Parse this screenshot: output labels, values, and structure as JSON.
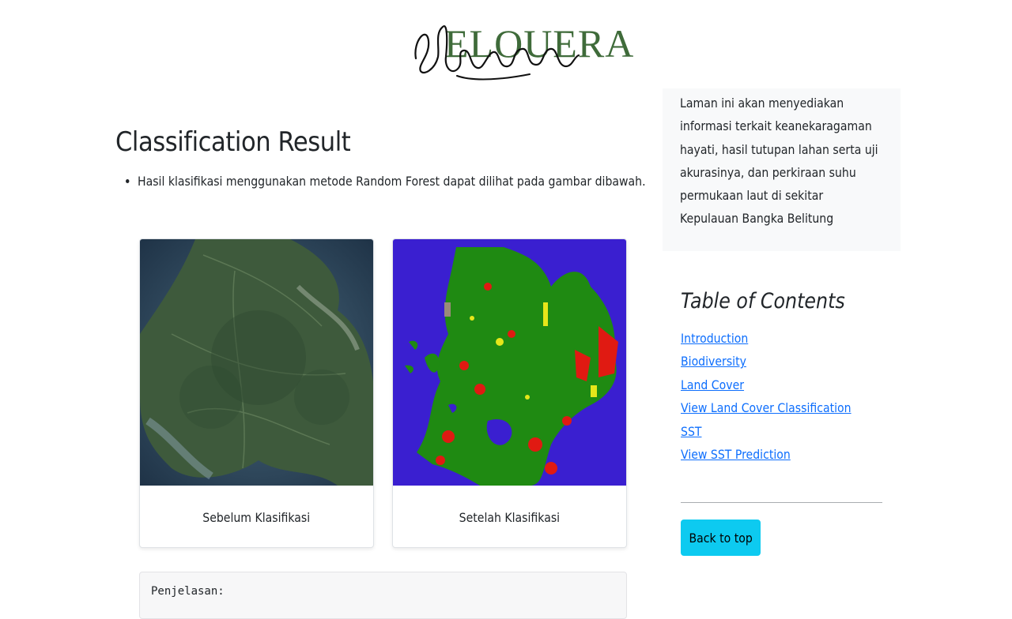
{
  "header": {
    "logo_text": "ELOUERA",
    "logo_script": "elouera"
  },
  "main": {
    "title": "Classification Result",
    "description": "Hasil klasifikasi menggunakan metode Random Forest dapat dilihat pada gambar dibawah.",
    "cards": [
      {
        "caption": "Sebelum Klasifikasi",
        "image": "satellite-map-before"
      },
      {
        "caption": "Setelah Klasifikasi",
        "image": "classified-map-after"
      }
    ],
    "explanation_label": "Penjelasan:"
  },
  "sidebar": {
    "about": "Laman ini akan menyediakan informasi terkait keanekaragaman hayati, hasil tutupan lahan serta uji akurasinya, dan perkiraan suhu permukaan laut di sekitar Kepulauan Bangka Belitung",
    "toc_title": "Table of Contents",
    "toc_links": [
      "Introduction",
      "Biodiversity",
      "Land Cover",
      "View Land Cover Classification",
      "SST",
      "View SST Prediction"
    ],
    "back_to_top": "Back to top"
  },
  "colors": {
    "link": "#0d6efd",
    "button": "#0dcaf0",
    "logo": "#3f6b3a",
    "class_water": "#3a1fd0",
    "class_vegetation": "#1f8a12",
    "class_built": "#e01a12",
    "class_bare": "#e6e61a"
  }
}
